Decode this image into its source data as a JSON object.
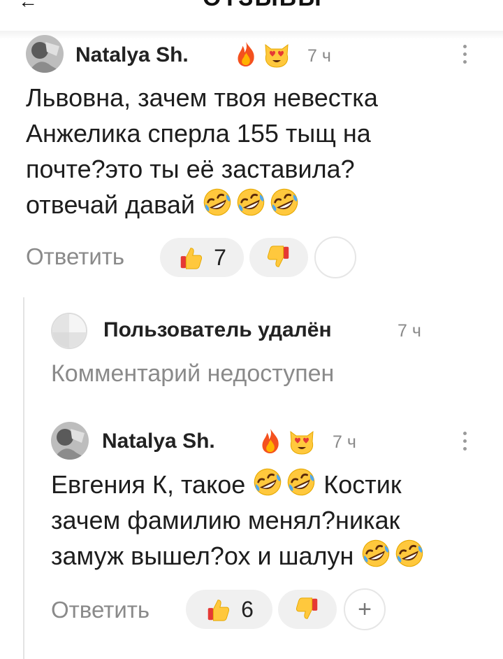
{
  "header": {
    "cut_title_fragment": "ОТЗЫВЫ"
  },
  "comments": [
    {
      "author": "Natalya Sh.",
      "badges": [
        "fire-emoji",
        "heart-eyes-cat-emoji"
      ],
      "time": "7 ч",
      "lines": [
        "Львовна, зачем твоя невестка",
        "Анжелика сперла 155 тыщ на",
        "почте?это ты её заставила?",
        "отвечай давай"
      ],
      "line4_emojis": 3,
      "reply_label": "Ответить",
      "likes": "7"
    },
    {
      "author": "Пользователь удалён",
      "time": "7 ч",
      "text": "Комментарий недоступен"
    },
    {
      "author": "Natalya Sh.",
      "badges": [
        "fire-emoji",
        "heart-eyes-cat-emoji"
      ],
      "time": "7 ч",
      "line1_a": "Евгения К, такое",
      "line1_b": "Костик",
      "line2": "зачем фамилию менял?никак",
      "line3": "замуж вышел?ох и шалун",
      "reply_label": "Ответить",
      "likes": "6",
      "add_reaction": "+"
    }
  ]
}
